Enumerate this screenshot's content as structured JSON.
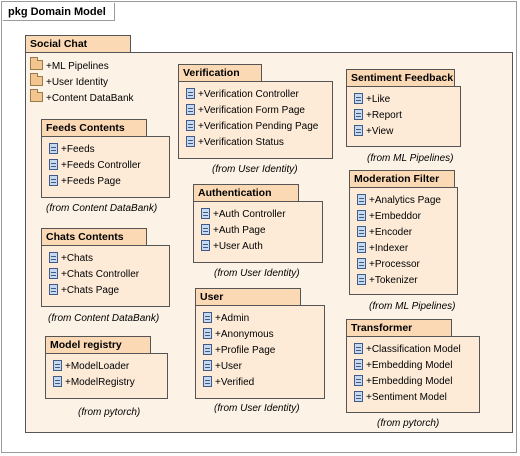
{
  "frame": {
    "title": "pkg Domain Model"
  },
  "outer_package": {
    "name": "Social Chat",
    "nested_packages": [
      "+ML Pipelines",
      "+User Identity",
      "+Content DataBank"
    ]
  },
  "packages": [
    {
      "id": "feeds",
      "name": "Feeds Contents",
      "items": [
        "+Feeds",
        "+Feeds Controller",
        "+Feeds Page"
      ],
      "from": "(from Content DataBank)"
    },
    {
      "id": "chats",
      "name": "Chats Contents",
      "items": [
        "+Chats",
        "+Chats Controller",
        "+Chats Page"
      ],
      "from": "(from Content DataBank)"
    },
    {
      "id": "registry",
      "name": "Model registry",
      "items": [
        "+ModelLoader",
        "+ModelRegistry"
      ],
      "from": "(from pytorch)"
    },
    {
      "id": "verification",
      "name": "Verification",
      "items": [
        "+Verification Controller",
        "+Verification Form Page",
        "+Verification Pending Page",
        "+Verification Status"
      ],
      "from": "(from User Identity)"
    },
    {
      "id": "authentication",
      "name": "Authentication",
      "items": [
        "+Auth Controller",
        "+Auth Page",
        "+User Auth"
      ],
      "from": "(from User Identity)"
    },
    {
      "id": "user",
      "name": "User",
      "items": [
        "+Admin",
        "+Anonymous",
        "+Profile Page",
        "+User",
        "+Verified"
      ],
      "from": "(from User Identity)"
    },
    {
      "id": "sentiment",
      "name": "Sentiment Feedback",
      "items": [
        "+Like",
        "+Report",
        "+View"
      ],
      "from": "(from ML Pipelines)"
    },
    {
      "id": "moderation",
      "name": "Moderation Filter",
      "items": [
        "+Analytics Page",
        "+Embeddor",
        "+Encoder",
        "+Indexer",
        "+Processor",
        "+Tokenizer"
      ],
      "from": "(from ML Pipelines)"
    },
    {
      "id": "transformer",
      "name": "Transformer",
      "items": [
        "+Classification Model",
        "+Embedding Model",
        "+Embedding Model",
        "+Sentiment Model"
      ],
      "from": "(from pytorch)"
    }
  ]
}
